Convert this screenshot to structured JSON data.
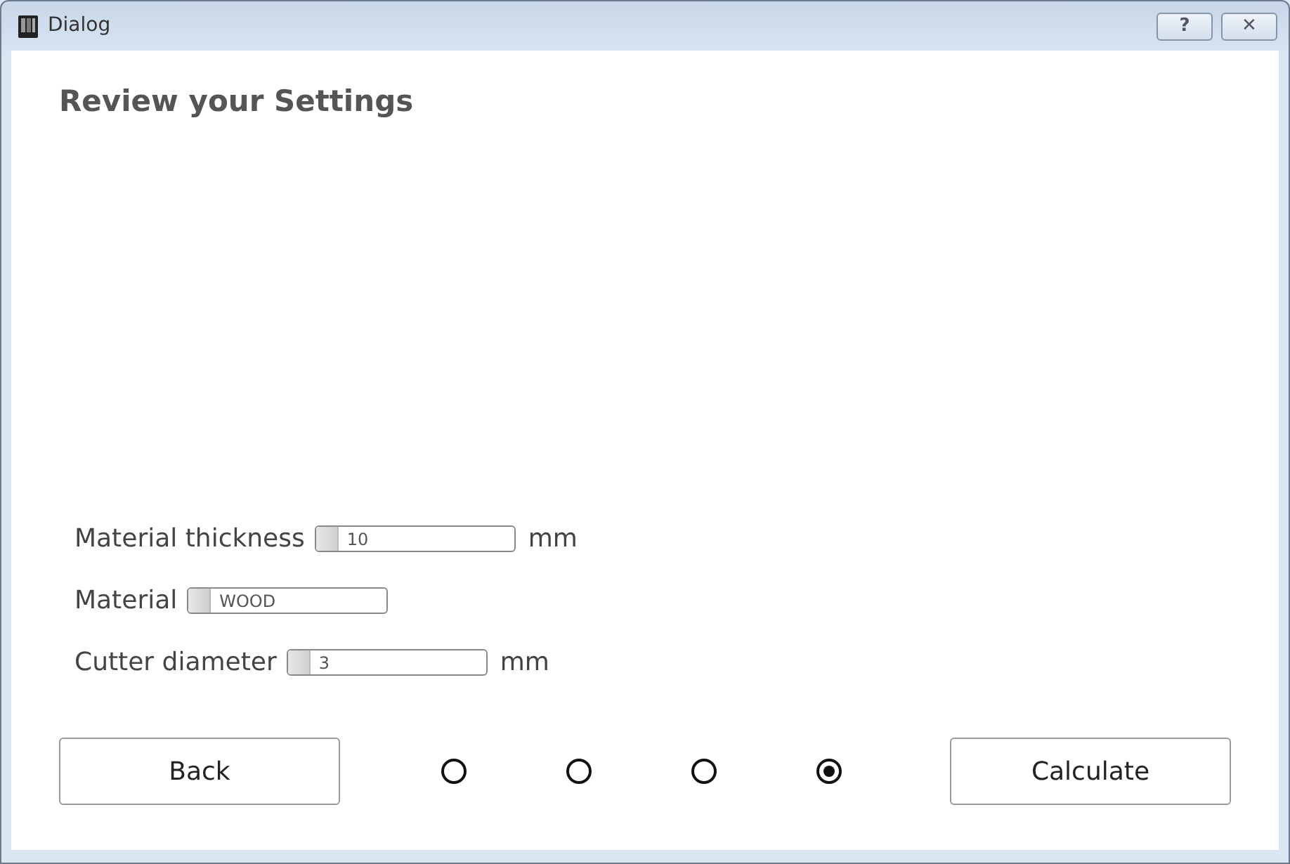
{
  "window": {
    "title": "Dialog",
    "buttons": [
      "?",
      "✕"
    ]
  },
  "heading": "Review your Settings",
  "settings": [
    {
      "label": "Material thickness",
      "value": "10",
      "unit": "mm"
    },
    {
      "label": "Material",
      "value": "WOOD"
    },
    {
      "label": "Cutter diameter",
      "value": "3",
      "unit": "mm"
    }
  ],
  "back_button": "Back",
  "pages": [
    {
      "selected": false
    },
    {
      "selected": false
    },
    {
      "selected": false
    },
    {
      "selected": true
    }
  ],
  "next_button": "Calculate"
}
